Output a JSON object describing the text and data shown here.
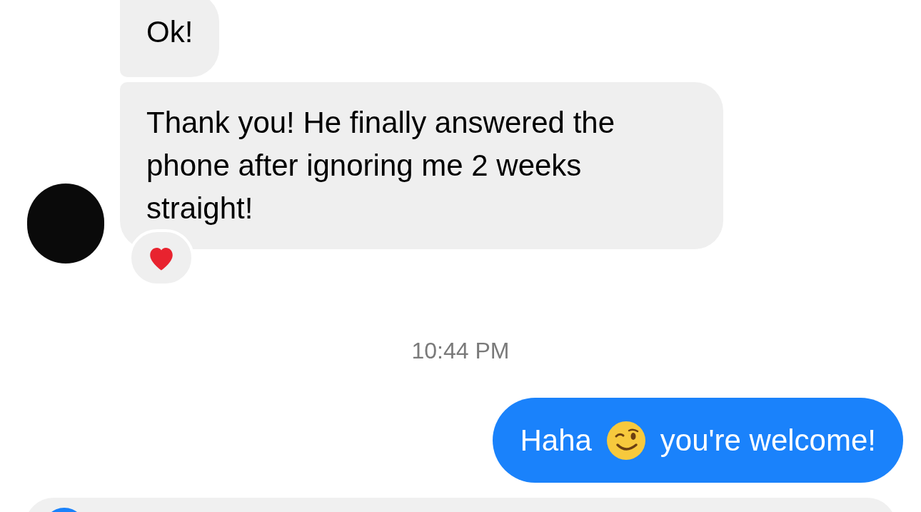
{
  "messages": [
    {
      "kind": "received",
      "text": "Ok!",
      "reacted": false,
      "avatar": false
    },
    {
      "kind": "received",
      "text": "Thank you! He finally answered the phone after ignoring me 2 weeks straight!",
      "reacted": true,
      "avatar": true
    },
    {
      "kind": "time",
      "text": "10:44 PM"
    },
    {
      "kind": "sent",
      "parts": [
        "Haha",
        "you're welcome!"
      ]
    }
  ]
}
